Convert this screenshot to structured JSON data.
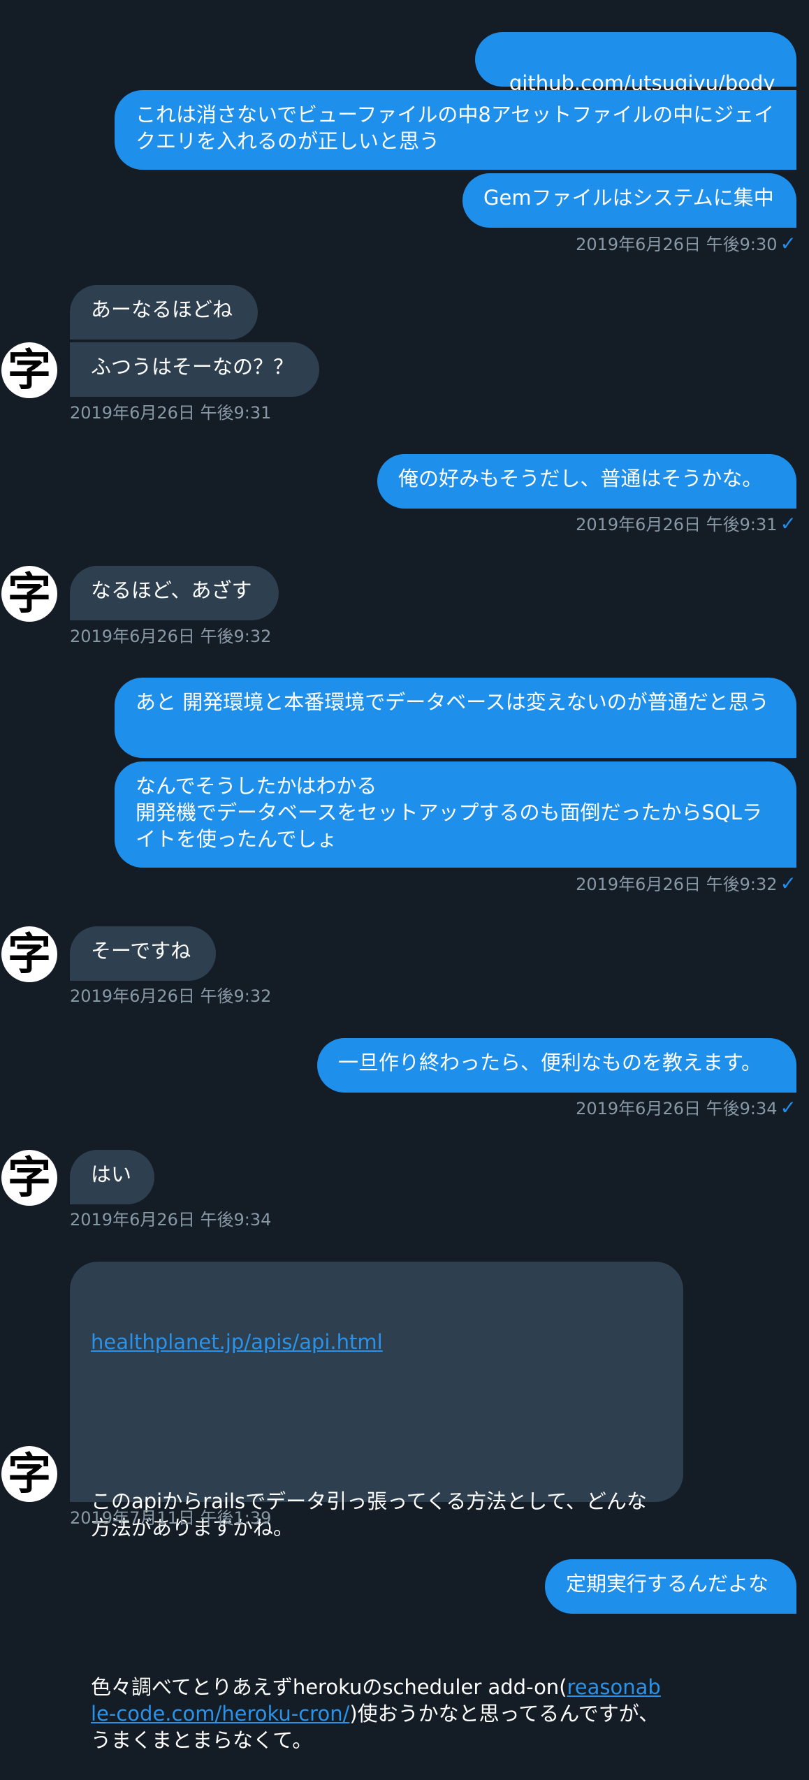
{
  "messages": {
    "m1": {
      "text": "github.com/utsugiyu/body_…"
    },
    "m2": {
      "text": "これは消さないでビューファイルの中8アセットファイルの中にジェイクエリを入れるのが正しいと思う"
    },
    "m3": {
      "text": "Gemファイルはシステムに集中"
    },
    "ts1": {
      "text": "2019年6月26日 午後9:30"
    },
    "m4": {
      "text": "あーなるほどね"
    },
    "m5": {
      "text": "ふつうはそーなの？？"
    },
    "ts2": {
      "text": "2019年6月26日 午後9:31"
    },
    "m6": {
      "text": "俺の好みもそうだし、普通はそうかな。"
    },
    "ts3": {
      "text": "2019年6月26日 午後9:31"
    },
    "m7": {
      "text": "なるほど、あざす"
    },
    "ts4": {
      "text": "2019年6月26日 午後9:32"
    },
    "m8": {
      "text": "あと 開発環境と本番環境でデータベースは変えないのが普通だと思う"
    },
    "m9": {
      "text": "なんでそうしたかはわかる\n開発機でデータベースをセットアップするのも面倒だったからSQLライトを使ったんでしょ"
    },
    "ts5": {
      "text": "2019年6月26日 午後9:32"
    },
    "m10": {
      "text": "そーですね"
    },
    "ts6": {
      "text": "2019年6月26日 午後9:32"
    },
    "m11": {
      "text": "一旦作り終わったら、便利なものを教えます。"
    },
    "ts7": {
      "text": "2019年6月26日 午後9:34"
    },
    "m12": {
      "text": "はい"
    },
    "ts8": {
      "text": "2019年6月26日 午後9:34"
    },
    "m13": {
      "link1": "healthplanet.jp/apis/api.html",
      "para1": "このapiからrailsでデータ引っ張ってくる方法として、どんな方法がありますかね。",
      "para2_pre": "色々調べてとりあえずherokuのscheduler add-on(",
      "link2": "reasonable-code.com/heroku-cron/",
      "para2_post": ")使おうかなと思ってるんですが、うまくまとまらなくて。"
    },
    "ts9": {
      "text": "2019年7月11日 午後1:39"
    },
    "m14": {
      "text": "定期実行するんだよな"
    }
  },
  "read_receipt": "✓",
  "avatar_glyph": "字",
  "colors": {
    "background": "#141c26",
    "outgoing_bubble": "#1e8fea",
    "incoming_bubble": "#2e3f4f",
    "timestamp": "#8899a6",
    "link": "#2a93e9"
  }
}
